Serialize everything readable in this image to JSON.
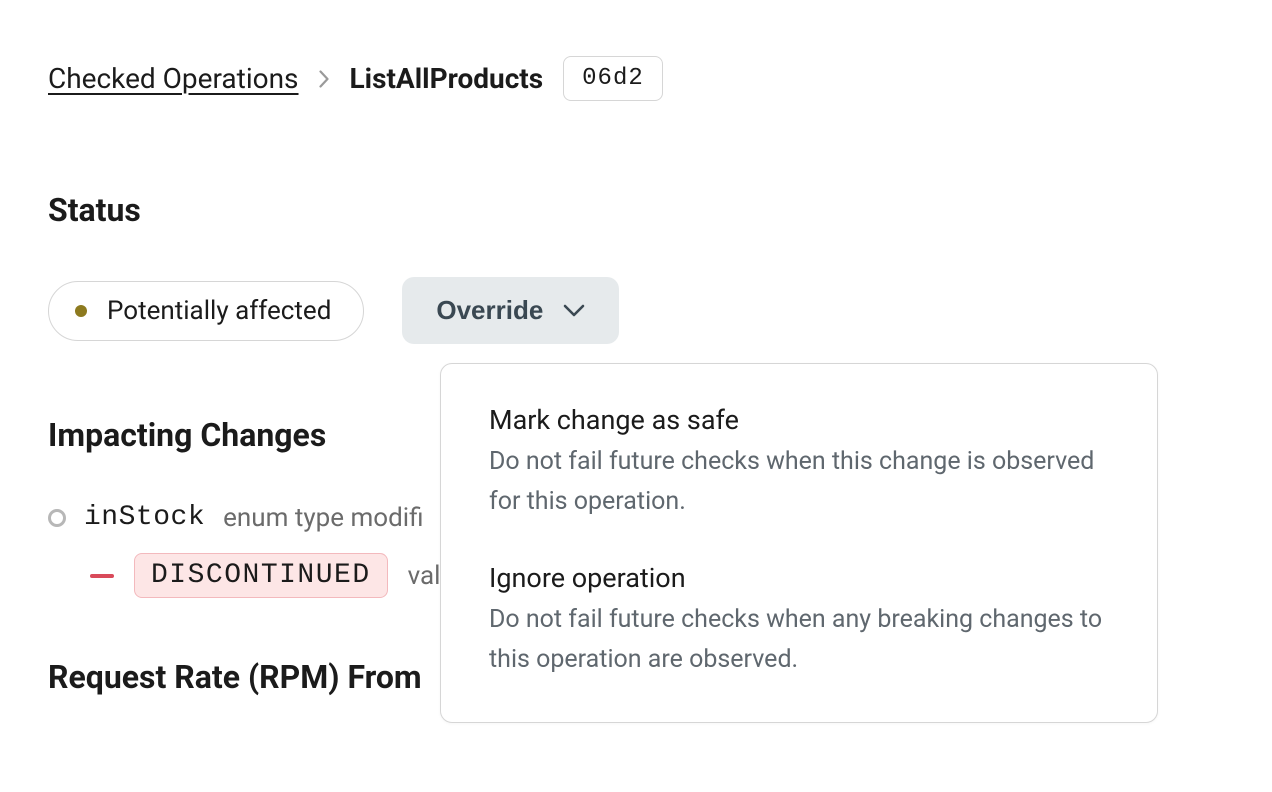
{
  "breadcrumb": {
    "parent": "Checked Operations",
    "current": "ListAllProducts",
    "hash": "06d2"
  },
  "status": {
    "heading": "Status",
    "label": "Potentially affected",
    "override_label": "Override",
    "menu": {
      "items": [
        {
          "title": "Mark change as safe",
          "desc": "Do not fail future checks when this change is observed for this operation."
        },
        {
          "title": "Ignore operation",
          "desc": "Do not fail future checks when any breaking changes to this operation are observed."
        }
      ]
    }
  },
  "impacting": {
    "heading": "Impacting Changes",
    "items": [
      {
        "field": "inStock",
        "desc": "enum type modifi",
        "removed_value": "DISCONTINUED",
        "removed_desc": "val"
      }
    ]
  },
  "request_rate": {
    "heading": "Request Rate (RPM) From"
  }
}
